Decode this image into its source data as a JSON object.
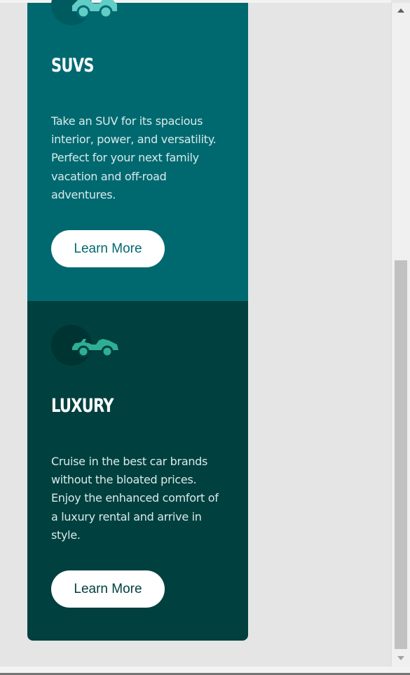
{
  "cards": [
    {
      "title": "SUVS",
      "description": "Take an SUV for its spacious interior, power, and versatility. Perfect for your next family vacation and off-road adventures.",
      "button_label": "Learn More",
      "icon": "suv-icon",
      "bg_color": "#006970",
      "icon_color": "#62cdc7"
    },
    {
      "title": "LUXURY",
      "description": "Cruise in the best car brands without the bloated prices. Enjoy the enhanced comfort of a luxury rental and arrive in style.",
      "button_label": "Learn More",
      "icon": "convertible-icon",
      "bg_color": "#00403f",
      "icon_color": "#2fae94"
    }
  ]
}
